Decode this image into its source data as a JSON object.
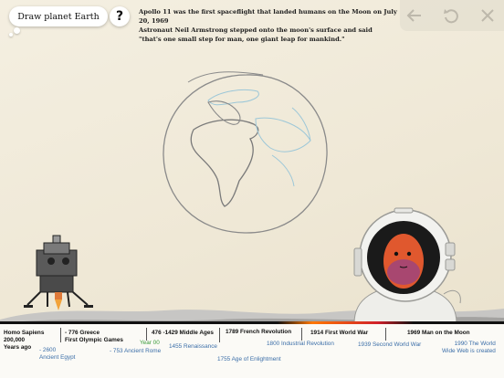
{
  "task": {
    "prompt": "Draw planet Earth",
    "help_label": "?"
  },
  "fact": {
    "line1": "Apollo 11 was the first spaceflight that landed humans on the Moon on July 20, 1969",
    "line2": "Astronaut Neil Armstrong stepped onto the moon's surface and said",
    "line3": "\"that's one small step for man, one giant leap for mankind.\""
  },
  "controls": [
    {
      "name": "back-arrow-icon"
    },
    {
      "name": "undo-icon"
    },
    {
      "name": "close-icon"
    }
  ],
  "timeline": {
    "homo_sapiens_1": "Homo Sapiens",
    "homo_sapiens_2": "200,000",
    "homo_sapiens_3": "Years ago",
    "egypt_1": "- 2600",
    "egypt_2": "Ancient Egypt",
    "greece_1": "- 776  Greece",
    "greece_2": "First Olympic Games",
    "rome": "- 753 Ancient Rome",
    "year00": "Year 00",
    "middle_ages": "476 -1429 Middle Ages",
    "renaissance": "1455 Renaissance",
    "enlightenment": "1755  Age of Enlightment",
    "french_rev": "1789 French Revolution",
    "industrial_rev": "1800 Industrial Revolution",
    "ww1": "1914 First World War",
    "ww2": "1939 Second World War",
    "moon": "1969 Man on the Moon",
    "www_1": "1990 The World",
    "www_2": "Wide Web is created"
  },
  "colors": {
    "paper": "#f1ebdc",
    "sketch": "#8a8a8a",
    "continents": "#9cc7d8",
    "timeline_blue": "#3b6ea8",
    "timeline_green": "#3a9b3a"
  },
  "illustrations": [
    "lunar-module",
    "astronaut-with-face",
    "moon-surface",
    "earth-sketch"
  ]
}
